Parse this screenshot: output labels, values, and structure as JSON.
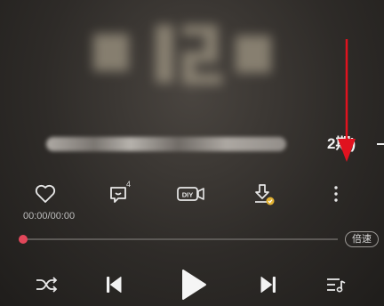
{
  "song": {
    "title_visible_suffix": "2期)"
  },
  "actions": {
    "comment_count": "4",
    "diy_label": "DIY"
  },
  "playback": {
    "time_display": "00:00/00:00",
    "progress": 0.0,
    "speed_label": "倍速"
  },
  "icons": [
    "heart-icon",
    "comment-icon",
    "diy-video-icon",
    "download-icon",
    "more-icon",
    "shuffle-icon",
    "previous-icon",
    "play-icon",
    "next-icon",
    "playlist-icon"
  ],
  "colors": {
    "progress_thumb": "#e2475a",
    "annotation_arrow": "#e0121f"
  }
}
